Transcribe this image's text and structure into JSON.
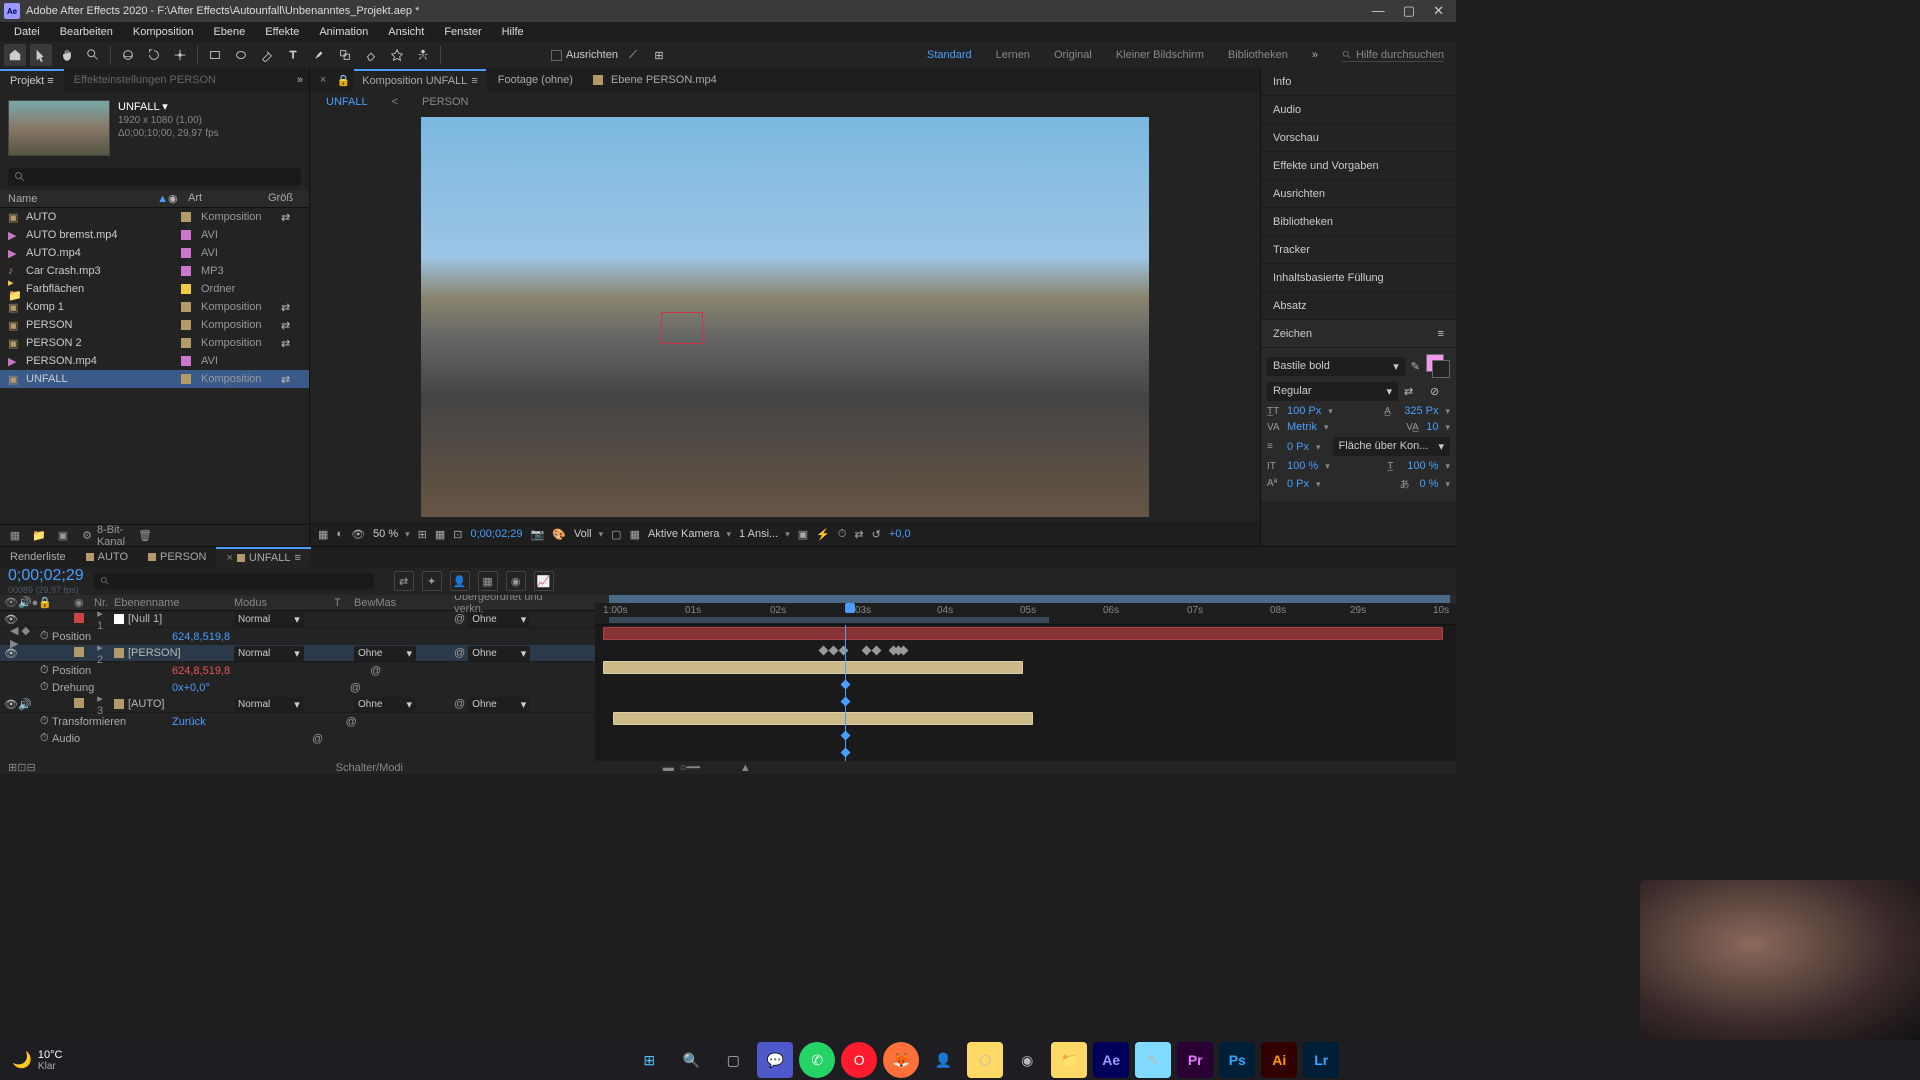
{
  "titlebar": {
    "app_icon_text": "Ae",
    "title": "Adobe After Effects 2020 - F:\\After Effects\\Autounfall\\Unbenanntes_Projekt.aep *"
  },
  "menubar": {
    "items": [
      "Datei",
      "Bearbeiten",
      "Komposition",
      "Ebene",
      "Effekte",
      "Animation",
      "Ansicht",
      "Fenster",
      "Hilfe"
    ]
  },
  "toolbar": {
    "ausrichten_label": "Ausrichten",
    "workspaces": [
      "Standard",
      "Lernen",
      "Original",
      "Kleiner Bildschirm",
      "Bibliotheken"
    ],
    "search_placeholder": "Hilfe durchsuchen"
  },
  "project": {
    "tab_label": "Projekt",
    "secondary_tab": "Effekteinstellungen PERSON",
    "name": "UNFALL ▾",
    "meta1": "1920 x 1080 (1,00)",
    "meta2": "Δ0;00;10;00, 29,97 fps",
    "columns": {
      "name": "Name",
      "art": "Art",
      "size": "Größ"
    },
    "items": [
      {
        "name": "AUTO",
        "art": "Komposition",
        "icon": "comp",
        "color": "#b49a6a"
      },
      {
        "name": "AUTO bremst.mp4",
        "art": "AVI",
        "icon": "video",
        "color": "#cc77cc"
      },
      {
        "name": "AUTO.mp4",
        "art": "AVI",
        "icon": "video",
        "color": "#cc77cc"
      },
      {
        "name": "Car Crash.mp3",
        "art": "MP3",
        "icon": "audio",
        "color": "#cc77cc"
      },
      {
        "name": "Farbflächen",
        "art": "Ordner",
        "icon": "folder",
        "color": "#eecc44"
      },
      {
        "name": "Komp 1",
        "art": "Komposition",
        "icon": "comp",
        "color": "#b49a6a"
      },
      {
        "name": "PERSON",
        "art": "Komposition",
        "icon": "comp",
        "color": "#b49a6a"
      },
      {
        "name": "PERSON 2",
        "art": "Komposition",
        "icon": "comp",
        "color": "#b49a6a"
      },
      {
        "name": "PERSON.mp4",
        "art": "AVI",
        "icon": "video",
        "color": "#cc77cc"
      },
      {
        "name": "UNFALL",
        "art": "Komposition",
        "icon": "comp",
        "color": "#b49a6a"
      }
    ],
    "bit_depth": "8-Bit-Kanal"
  },
  "comp": {
    "tabs": [
      {
        "label": "Komposition UNFALL",
        "active": true
      },
      {
        "label": "Footage (ohne)"
      },
      {
        "label": "Ebene PERSON.mp4"
      }
    ],
    "subtabs": [
      "UNFALL",
      "<",
      "PERSON"
    ],
    "controls": {
      "zoom": "50 %",
      "timecode": "0;00;02;29",
      "resolution": "Voll",
      "camera": "Aktive Kamera",
      "views": "1 Ansi...",
      "exposure": "+0,0"
    }
  },
  "right_panels": {
    "items": [
      "Info",
      "Audio",
      "Vorschau",
      "Effekte und Vorgaben",
      "Ausrichten",
      "Bibliotheken",
      "Tracker",
      "Inhaltsbasierte Füllung",
      "Absatz",
      "Zeichen"
    ],
    "zeichen": {
      "font": "Bastile bold",
      "style": "Regular",
      "size": "100 Px",
      "leading": "325 Px",
      "kerning": "Metrik",
      "tracking": "10",
      "stroke": "0 Px",
      "stroke_mode": "Fläche über Kon...",
      "hscale": "100 %",
      "vscale": "100 %",
      "baseline": "0 Px",
      "tsume": "0 %"
    }
  },
  "timeline": {
    "tabs": [
      {
        "label": "Renderliste"
      },
      {
        "label": "AUTO"
      },
      {
        "label": "PERSON"
      },
      {
        "label": "UNFALL",
        "active": true
      }
    ],
    "timecode": "0;00;02;29",
    "timecode_sub": "00089 (29,97 fps)",
    "columns": {
      "nr": "Nr.",
      "name": "Ebenenname",
      "mode": "Modus",
      "t": "T",
      "bewmas": "BewMas",
      "parent": "Übergeordnet und verkn."
    },
    "ruler_ticks": [
      "1:00s",
      "01s",
      "02s",
      "03s",
      "04s",
      "05s",
      "06s",
      "07s",
      "08s",
      "29s",
      "10s"
    ],
    "layers": [
      {
        "num": "1",
        "name": "[Null 1]",
        "color": "#cc4444",
        "mode": "Normal",
        "bewmas": "",
        "parent": "Ohne",
        "props": [
          {
            "name": "Position",
            "val": "624,8,519,8",
            "keyframed": true
          }
        ]
      },
      {
        "num": "2",
        "name": "[PERSON]",
        "color": "#b49a6a",
        "mode": "Normal",
        "bewmas": "Ohne",
        "parent": "Ohne",
        "selected": true,
        "props": [
          {
            "name": "Position",
            "val": "624,8,519,8",
            "highlight": true
          },
          {
            "name": "Drehung",
            "val": "0x+0,0°"
          }
        ]
      },
      {
        "num": "3",
        "name": "[AUTO]",
        "color": "#b49a6a",
        "mode": "Normal",
        "bewmas": "Ohne",
        "parent": "Ohne",
        "props": [
          {
            "name": "Transformieren",
            "val": "Zurück"
          },
          {
            "name": "Audio",
            "val": ""
          }
        ]
      }
    ],
    "footer_label": "Schalter/Modi"
  },
  "taskbar": {
    "weather": {
      "temp": "10°C",
      "cond": "Klar"
    }
  }
}
